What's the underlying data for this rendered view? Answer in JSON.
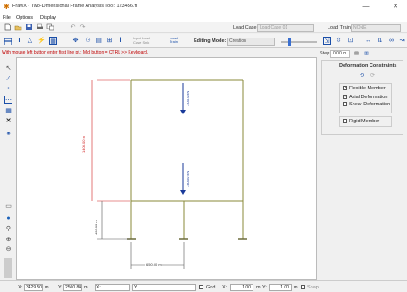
{
  "window": {
    "title": "FrawX - Two-Dimensional Frame Analysis Tool: 123456.fr",
    "minimize": "—",
    "close": "✕"
  },
  "menu": {
    "file": "File",
    "options": "Options",
    "display": "Display"
  },
  "toolbar": {
    "load_case_label": "Load Case:",
    "load_case_value": "Load Case 01",
    "load_train_label": "Load Train:",
    "load_train_value": "NONE",
    "editing_mode_label": "Editing Mode:",
    "editing_mode_value": "Creation",
    "input_load_label": "Input Load",
    "case_sink_label": "Case Sink",
    "load_train_btn": "Load Train",
    "step_label": "Step:",
    "step_value": "0.00 m"
  },
  "hint": "With mouse left button enter first line pt.; Mid button = CTRL >> Keyboard.",
  "panel": {
    "title": "Deformation Constraints",
    "flexible_member": "Flexible Member",
    "axial_deformation": "Axial Deformation",
    "shear_deformation": "Shear Deformation",
    "rigid_member": "Rigid Member",
    "flexible_checked": true,
    "axial_checked": true,
    "shear_checked": false,
    "rigid_checked": false
  },
  "canvas": {
    "dim_vertical_upper": "1400.00 m",
    "dim_vertical_lower": "400.00 m",
    "dim_horizontal": "650.00 m",
    "load_upper": "-400.0 kN",
    "load_lower": "-400.0 kN"
  },
  "status": {
    "x_label": "X:",
    "x_value": "3429.50",
    "x_unit": "m",
    "y_label": "Y:",
    "y_value": "2500.84",
    "y_unit": "m",
    "x2_label": "X:",
    "y2_label": "Y:",
    "grid_label": "Grid",
    "grid_x_label": "X:",
    "grid_x_value": "1.00",
    "grid_x_unit": "m",
    "grid_y_label": "Y:",
    "grid_y_value": "1.00",
    "grid_y_unit": "m",
    "snap_label": "Snap"
  }
}
